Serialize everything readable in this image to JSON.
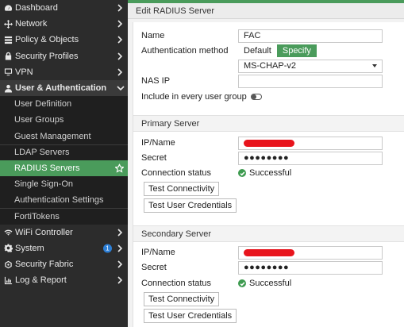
{
  "sidebar": {
    "items": [
      {
        "label": "Dashboard",
        "icon": "dashboard-icon"
      },
      {
        "label": "Network",
        "icon": "network-icon"
      },
      {
        "label": "Policy & Objects",
        "icon": "policy-icon"
      },
      {
        "label": "Security Profiles",
        "icon": "lock-icon"
      },
      {
        "label": "VPN",
        "icon": "monitor-icon"
      },
      {
        "label": "User & Authentication",
        "icon": "user-icon"
      }
    ],
    "sub_items": [
      {
        "label": "User Definition"
      },
      {
        "label": "User Groups"
      },
      {
        "label": "Guest Management"
      },
      {
        "label": "LDAP Servers"
      },
      {
        "label": "RADIUS Servers"
      },
      {
        "label": "Single Sign-On"
      },
      {
        "label": "Authentication Settings"
      },
      {
        "label": "FortiTokens"
      }
    ],
    "bottom_items": [
      {
        "label": "WiFi Controller",
        "icon": "wifi-icon"
      },
      {
        "label": "System",
        "icon": "gear-icon",
        "badge": "1"
      },
      {
        "label": "Security Fabric",
        "icon": "fabric-icon"
      },
      {
        "label": "Log & Report",
        "icon": "chart-icon"
      }
    ]
  },
  "colors": {
    "accent": "#4a9b5b",
    "sidebar_bg": "#2c2c2c",
    "badge": "#2d7fd6",
    "redaction": "#e8141c"
  },
  "header": {
    "title": "Edit RADIUS Server"
  },
  "form": {
    "name_label": "Name",
    "name_value": "FAC",
    "auth_label": "Authentication method",
    "auth_default": "Default",
    "auth_specify": "Specify",
    "auth_select_value": "MS-CHAP-v2",
    "nas_ip_label": "NAS IP",
    "nas_ip_value": "",
    "include_label": "Include in every user group"
  },
  "primary": {
    "title": "Primary Server",
    "ip_label": "IP/Name",
    "secret_label": "Secret",
    "secret_value": "●●●●●●●●",
    "status_label": "Connection status",
    "status_value": "Successful",
    "test_conn": "Test Connectivity",
    "test_creds": "Test User Credentials"
  },
  "secondary": {
    "title": "Secondary Server",
    "ip_label": "IP/Name",
    "secret_label": "Secret",
    "secret_value": "●●●●●●●●",
    "status_label": "Connection status",
    "status_value": "Successful",
    "test_conn": "Test Connectivity",
    "test_creds": "Test User Credentials"
  }
}
